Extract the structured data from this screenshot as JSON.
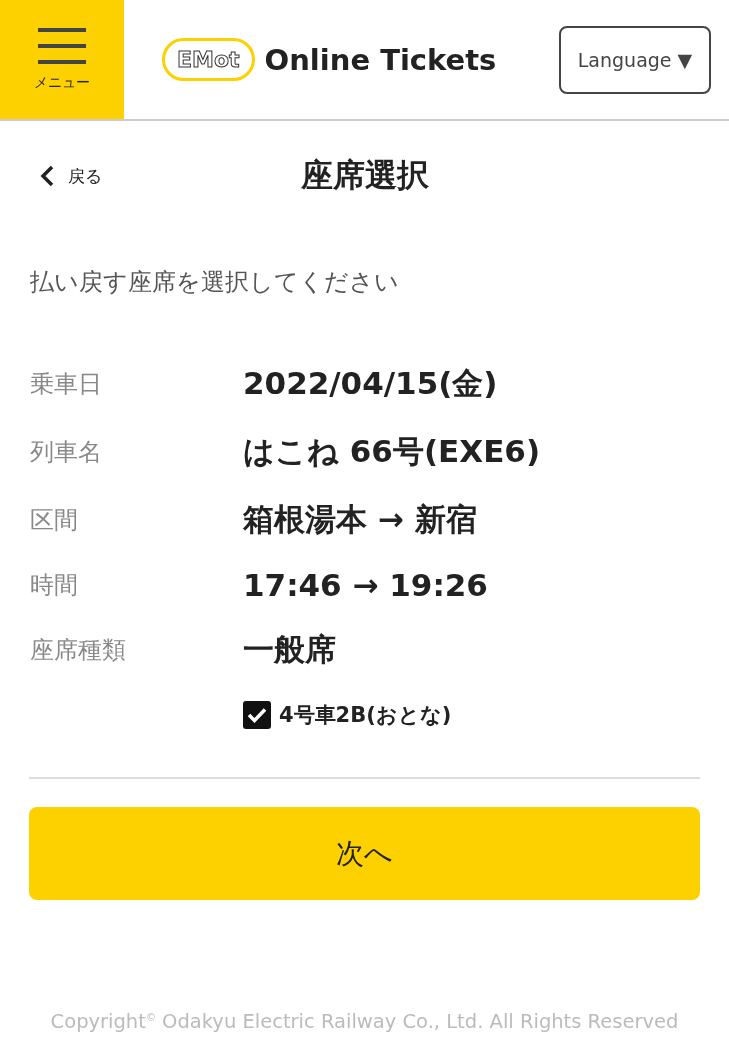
{
  "header": {
    "menu_label": "メニュー",
    "logo_text": "EMot",
    "site_title": "Online Tickets",
    "language_button": "Language ▼"
  },
  "nav": {
    "back_label": "戻る",
    "title": "座席選択"
  },
  "instruction": "払い戻す座席を選択してください",
  "details": [
    {
      "label": "乗車日",
      "value": "2022/04/15(金)"
    },
    {
      "label": "列車名",
      "value": "はこね 66号(EXE6)"
    },
    {
      "label": "区間",
      "value": "箱根湯本 → 新宿"
    },
    {
      "label": "時間",
      "value": "17:46 → 19:26"
    },
    {
      "label": "座席種類",
      "value": "一般席"
    }
  ],
  "seats": [
    {
      "label": "4号車2B(おとな)",
      "checked": true
    }
  ],
  "next_button": "次へ",
  "footer": "Copyright$^{©}$ Odakyu Electric Railway Co., Ltd. All Rights Reserved"
}
